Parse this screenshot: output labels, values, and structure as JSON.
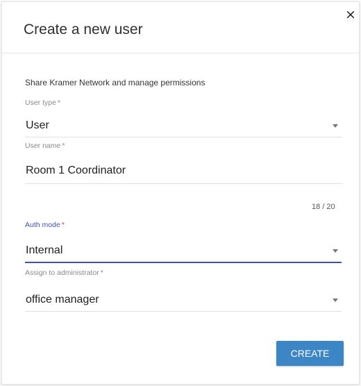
{
  "dialog": {
    "title": "Create a new user",
    "close_glyph": "×",
    "subtitle": "Share Kramer Network and manage permissions"
  },
  "fields": {
    "user_type": {
      "label": "User type",
      "required_mark": "*",
      "value": "User"
    },
    "user_name": {
      "label": "User name",
      "required_mark": "*",
      "value": "Room 1 Coordinator",
      "counter": "18 / 20"
    },
    "auth_mode": {
      "label": "Auth mode",
      "required_mark": "*",
      "value": "Internal"
    },
    "assign_admin": {
      "label": "Assign to administrator",
      "required_mark": "*",
      "value": "office manager"
    }
  },
  "actions": {
    "create_label": "CREATE"
  },
  "colors": {
    "accent": "#3f51b5",
    "button": "#3d86c6",
    "required_active": "#e53935"
  },
  "icons": {
    "close": "close-icon",
    "dropdown": "chevron-down-icon"
  }
}
